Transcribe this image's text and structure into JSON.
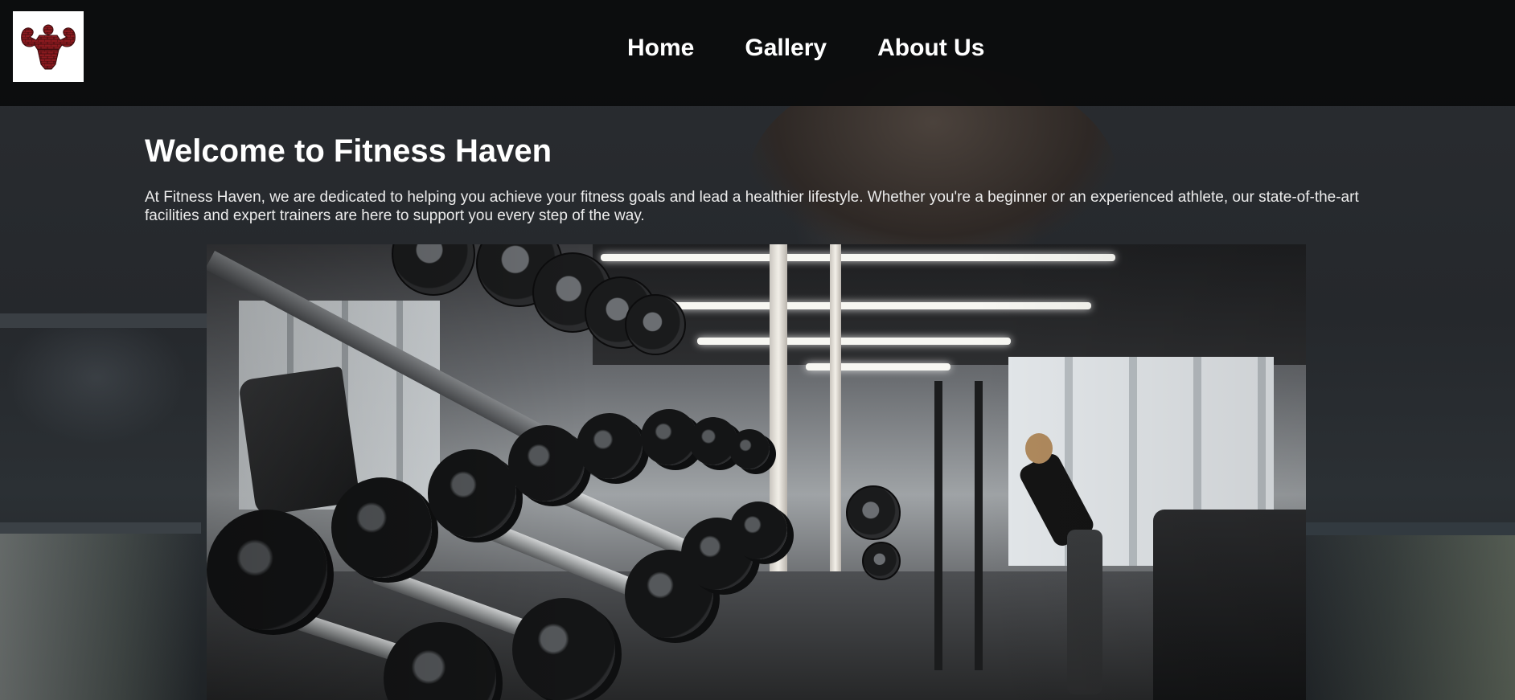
{
  "header": {
    "logo": {
      "name": "fitness-haven-logo",
      "alt": "Muscle flexing logo"
    },
    "nav": [
      {
        "label": "Home"
      },
      {
        "label": "Gallery"
      },
      {
        "label": "About Us"
      }
    ]
  },
  "main": {
    "title": "Welcome to Fitness Haven",
    "intro": "At Fitness Haven, we are dedicated to helping you achieve your fitness goals and lead a healthier lifestyle. Whether you're a beginner or an experienced athlete, our state-of-the-art facilities and expert trainers are here to support you every step of the way.",
    "hero_image": {
      "alt": "Gym dumbbell rack with person training in background"
    }
  },
  "colors": {
    "header_bg": "#0a0b0c",
    "text": "#ffffff",
    "logo_red": "#8b1a1f"
  }
}
